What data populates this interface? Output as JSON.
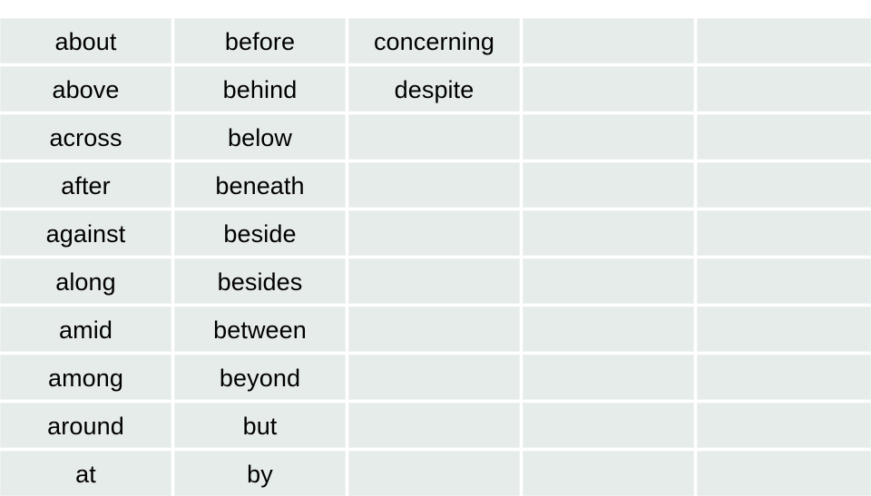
{
  "slide": {
    "background_color": "#ffffff",
    "title": ""
  },
  "table": {
    "cell_fill_color": "#e6ecea",
    "gridline_color": "#ffffff",
    "text_color": "#000000",
    "columns": 5,
    "rows": 10,
    "column_headers": [
      "",
      "",
      "",
      "",
      ""
    ],
    "cells": [
      [
        "about",
        "before",
        "concerning",
        "",
        ""
      ],
      [
        "above",
        "behind",
        "despite",
        "",
        ""
      ],
      [
        "across",
        "below",
        "",
        "",
        ""
      ],
      [
        "after",
        "beneath",
        "",
        "",
        ""
      ],
      [
        "against",
        "beside",
        "",
        "",
        ""
      ],
      [
        "along",
        "besides",
        "",
        "",
        ""
      ],
      [
        "amid",
        "between",
        "",
        "",
        ""
      ],
      [
        "among",
        "beyond",
        "",
        "",
        ""
      ],
      [
        "around",
        "but",
        "",
        "",
        ""
      ],
      [
        "at",
        "by",
        "",
        "",
        ""
      ]
    ]
  }
}
